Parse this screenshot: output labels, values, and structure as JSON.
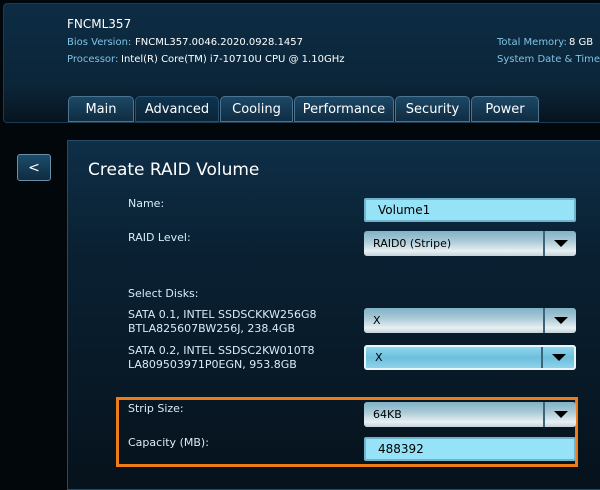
{
  "header": {
    "model": "FNCML357",
    "bios_label": "Bios Version:",
    "bios_value": "FNCML357.0046.2020.0928.1457",
    "processor_label": "Processor:",
    "processor_value": "Intel(R) Core(TM) i7-10710U CPU @ 1.10GHz",
    "memory_label": "Total Memory:",
    "memory_value": "8 GB",
    "datetime_label": "System Date & Time:"
  },
  "tabs": [
    "Main",
    "Advanced",
    "Cooling",
    "Performance",
    "Security",
    "Power"
  ],
  "active_tab": "Advanced",
  "back_label": "<",
  "page_title": "Create RAID Volume",
  "form": {
    "name_label": "Name:",
    "name_value": "Volume1",
    "raid_label": "RAID Level:",
    "raid_value": "RAID0 (Stripe)",
    "disks_label": "Select Disks:",
    "disks": [
      {
        "line1": "SATA 0.1, INTEL SSDSCKKW256G8",
        "line2": "BTLA825607BW256J, 238.4GB",
        "value": "X"
      },
      {
        "line1": "SATA 0.2, INTEL SSDSC2KW010T8",
        "line2": "LA809503971P0EGN, 953.8GB",
        "value": "X"
      }
    ],
    "strip_label": "Strip Size:",
    "strip_value": "64KB",
    "capacity_label": "Capacity (MB):",
    "capacity_value": "488392"
  },
  "colors": {
    "highlight": "#f07c18",
    "input_bg": "#96e2f7"
  }
}
